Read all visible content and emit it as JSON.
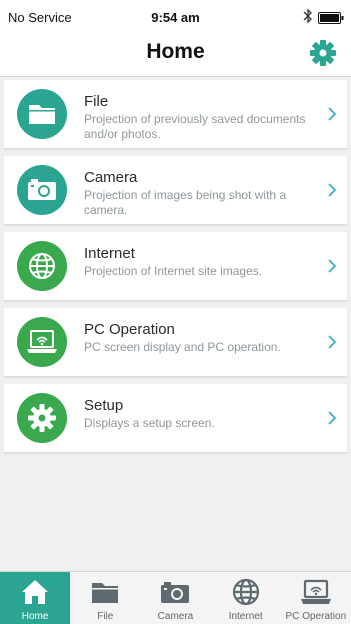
{
  "status_bar": {
    "carrier": "No Service",
    "time": "9:54 am",
    "bluetooth_icon": "bluetooth-icon",
    "battery_icon": "battery-icon"
  },
  "nav": {
    "title": "Home",
    "settings_icon": "gear-icon"
  },
  "colors": {
    "accent": "#2aa592",
    "green_icon": "#3aa84d",
    "chevron": "#35a9bf"
  },
  "menu": {
    "items": [
      {
        "title": "File",
        "description": "Projection of previously saved documents and/or photos.",
        "icon": "folder-icon"
      },
      {
        "title": "Camera",
        "description": "Projection of images being shot with a camera.",
        "icon": "camera-icon"
      },
      {
        "title": "Internet",
        "description": "Projection of Internet site images.",
        "icon": "globe-icon"
      },
      {
        "title": "PC Operation",
        "description": "PC screen display and PC operation.",
        "icon": "laptop-icon"
      },
      {
        "title": "Setup",
        "description": "Displays a setup screen.",
        "icon": "gear-icon"
      }
    ]
  },
  "tabs": {
    "items": [
      {
        "label": "Home",
        "icon": "home-icon",
        "active": true
      },
      {
        "label": "File",
        "icon": "folder-icon",
        "active": false
      },
      {
        "label": "Camera",
        "icon": "camera-icon",
        "active": false
      },
      {
        "label": "Internet",
        "icon": "globe-icon",
        "active": false
      },
      {
        "label": "PC Operation",
        "icon": "laptop-icon",
        "active": false
      }
    ]
  }
}
